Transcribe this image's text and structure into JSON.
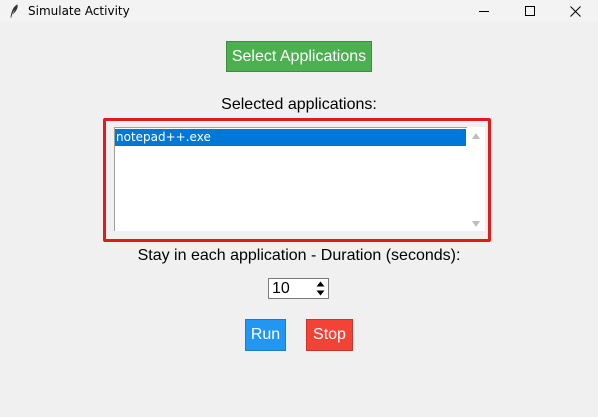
{
  "window": {
    "title": "Simulate Activity",
    "icon": "feather-icon"
  },
  "toolbar": {
    "select_label": "Select Applications",
    "select_color": "#4caf50"
  },
  "applications": {
    "label": "Selected applications:",
    "items": [
      "notepad++.exe"
    ],
    "selected_index": 0,
    "highlight_color": "#e21a1a"
  },
  "duration": {
    "label": "Stay in each application - Duration (seconds):",
    "value": "10"
  },
  "actions": {
    "run_label": "Run",
    "run_color": "#2196f3",
    "stop_label": "Stop",
    "stop_color": "#f44336"
  }
}
